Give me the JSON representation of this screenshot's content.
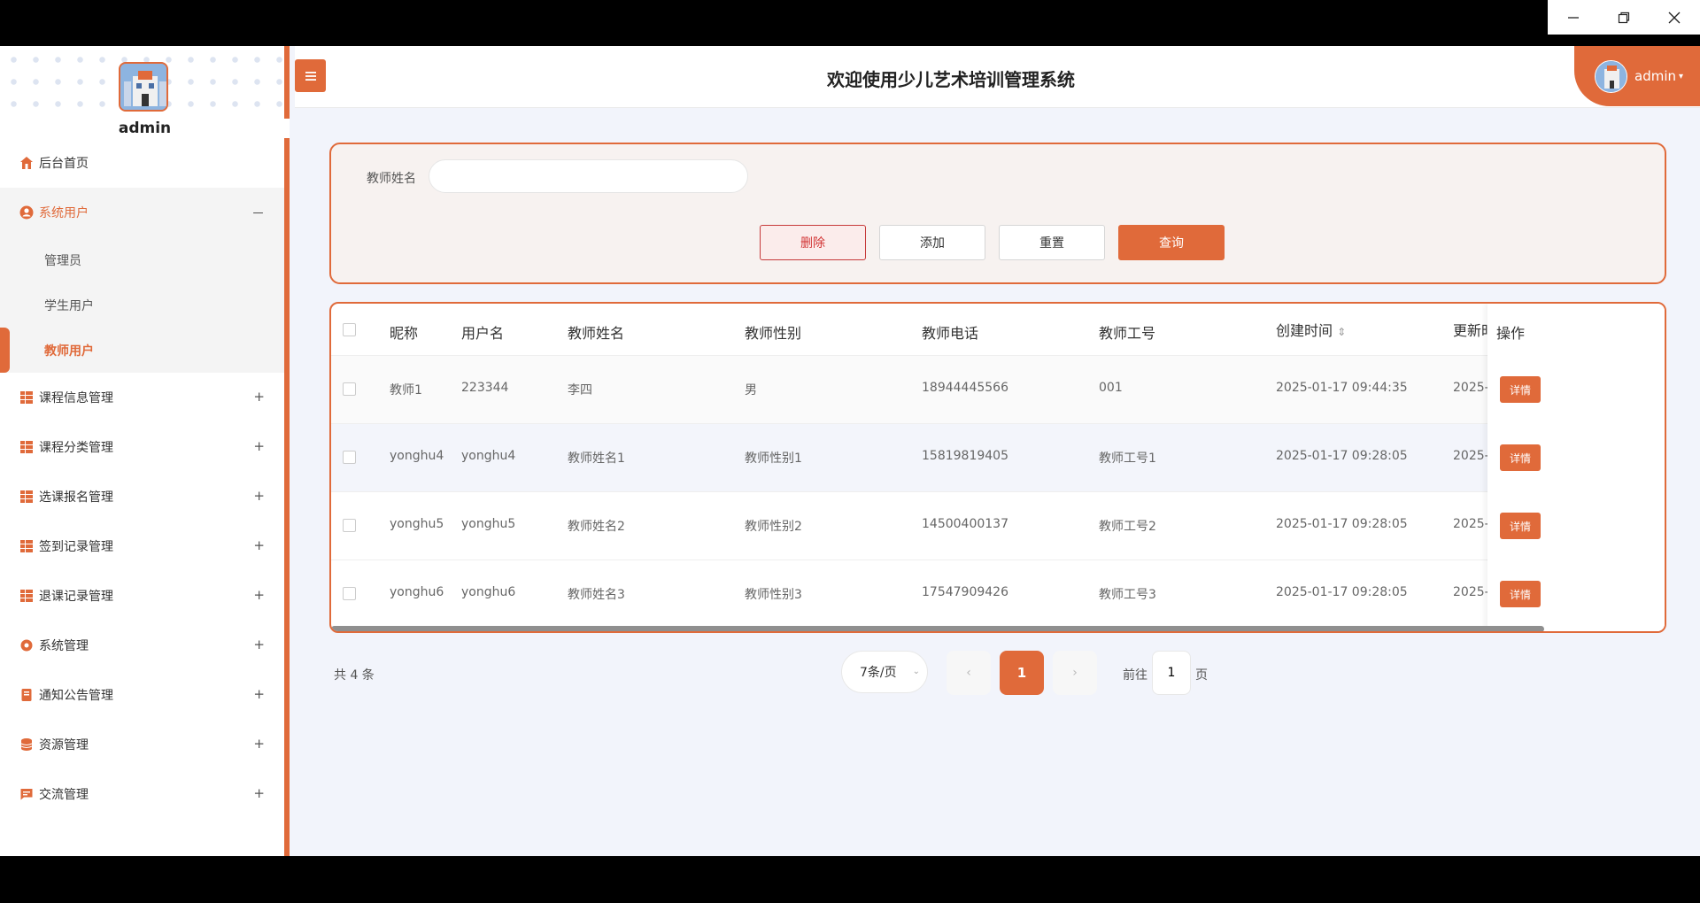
{
  "header": {
    "title": "欢迎使用少儿艺术培训管理系统",
    "username": "admin"
  },
  "sidebar": {
    "admin_name": "admin",
    "items": [
      {
        "label": "后台首页",
        "icon": "home-icon"
      },
      {
        "label": "系统用户",
        "icon": "user-circle-icon",
        "expanded": true
      },
      {
        "label": "课程信息管理",
        "icon": "grid-icon"
      },
      {
        "label": "课程分类管理",
        "icon": "grid-icon"
      },
      {
        "label": "选课报名管理",
        "icon": "grid-icon"
      },
      {
        "label": "签到记录管理",
        "icon": "grid-icon"
      },
      {
        "label": "退课记录管理",
        "icon": "grid-icon"
      },
      {
        "label": "系统管理",
        "icon": "settings-icon"
      },
      {
        "label": "通知公告管理",
        "icon": "document-icon"
      },
      {
        "label": "资源管理",
        "icon": "database-icon"
      },
      {
        "label": "交流管理",
        "icon": "chat-icon"
      }
    ],
    "sub_items": [
      "管理员",
      "学生用户",
      "教师用户"
    ],
    "expanded_marker": "－",
    "collapsed_marker": "+"
  },
  "search": {
    "label": "教师姓名",
    "value": "",
    "buttons": {
      "delete": "删除",
      "add": "添加",
      "reset": "重置",
      "query": "查询"
    }
  },
  "table": {
    "headers": [
      "昵称",
      "用户名",
      "教师姓名",
      "教师性别",
      "教师电话",
      "教师工号",
      "创建时间",
      "更新时",
      "操作"
    ],
    "sort_indicator": "⇕",
    "rows": [
      {
        "nickname": "教师1",
        "username": "223344",
        "name": "李四",
        "gender": "男",
        "phone": "18944445566",
        "code": "001",
        "created": "2025-01-17 09:44:35",
        "updated": "2025-",
        "action": "详情"
      },
      {
        "nickname": "yonghu4",
        "username": "yonghu4",
        "name": "教师姓名1",
        "gender": "教师性别1",
        "phone": "15819819405",
        "code": "教师工号1",
        "created": "2025-01-17 09:28:05",
        "updated": "2025-",
        "action": "详情"
      },
      {
        "nickname": "yonghu5",
        "username": "yonghu5",
        "name": "教师姓名2",
        "gender": "教师性别2",
        "phone": "14500400137",
        "code": "教师工号2",
        "created": "2025-01-17 09:28:05",
        "updated": "2025-",
        "action": "详情"
      },
      {
        "nickname": "yonghu6",
        "username": "yonghu6",
        "name": "教师姓名3",
        "gender": "教师性别3",
        "phone": "17547909426",
        "code": "教师工号3",
        "created": "2025-01-17 09:28:05",
        "updated": "2025-",
        "action": "详情"
      }
    ]
  },
  "pagination": {
    "total": "共 4 条",
    "page_size": "7条/页",
    "current_page": "1",
    "goto_prefix": "前往",
    "goto_value": "1",
    "goto_suffix": "页"
  },
  "colors": {
    "accent": "#e06a3a",
    "danger": "#d23434"
  }
}
